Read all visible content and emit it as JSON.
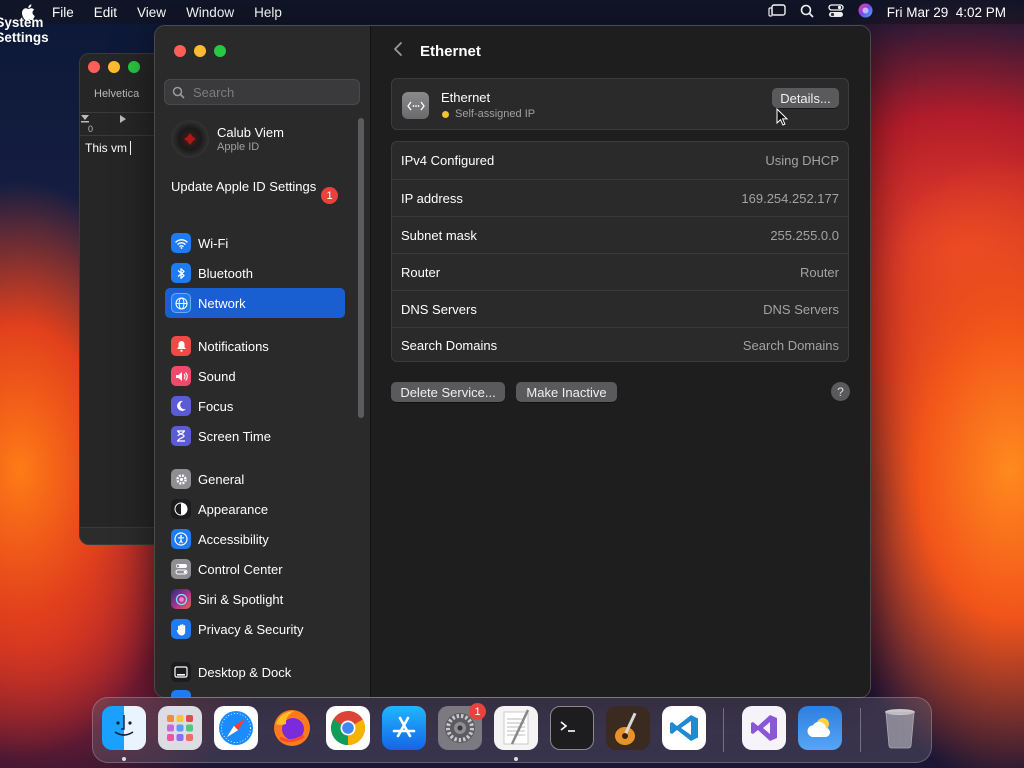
{
  "menubar": {
    "app_name": "System Settings",
    "menus": [
      "File",
      "Edit",
      "View",
      "Window",
      "Help"
    ],
    "datetime": "Fri Mar 29  4:02 PM"
  },
  "background_window": {
    "font_name": "Helvetica",
    "ruler_zero": "0",
    "document_text": "This vm"
  },
  "sidebar": {
    "search_placeholder": "Search",
    "account_name": "Calub Viem",
    "account_subtitle": "Apple ID",
    "update_label": "Update Apple ID Settings",
    "update_badge": "1",
    "items": [
      {
        "label": "Wi-Fi",
        "icon": "wifi-icon",
        "color": "#1e7bf2",
        "selected": false
      },
      {
        "label": "Bluetooth",
        "icon": "bluetooth-icon",
        "color": "#1e7bf2",
        "selected": false
      },
      {
        "label": "Network",
        "icon": "globe-icon",
        "color": "#1e7bf2",
        "selected": true
      },
      {
        "label": "Notifications",
        "icon": "bell-icon",
        "color": "#ef4a46",
        "selected": false
      },
      {
        "label": "Sound",
        "icon": "speaker-icon",
        "color": "#ef4a6a",
        "selected": false
      },
      {
        "label": "Focus",
        "icon": "moon-icon",
        "color": "#5b5bd6",
        "selected": false
      },
      {
        "label": "Screen Time",
        "icon": "hourglass-icon",
        "color": "#5b5bd6",
        "selected": false
      },
      {
        "label": "General",
        "icon": "gear-icon",
        "color": "#8e8e93",
        "selected": false
      },
      {
        "label": "Appearance",
        "icon": "appearance-icon",
        "color": "#1c1c1e",
        "selected": false
      },
      {
        "label": "Accessibility",
        "icon": "accessibility-icon",
        "color": "#1e7bf2",
        "selected": false
      },
      {
        "label": "Control Center",
        "icon": "control-center-icon",
        "color": "#8e8e93",
        "selected": false
      },
      {
        "label": "Siri & Spotlight",
        "icon": "siri-icon",
        "color": "#b4368c",
        "selected": false
      },
      {
        "label": "Privacy & Security",
        "icon": "hand-icon",
        "color": "#1e7bf2",
        "selected": false
      },
      {
        "label": "Desktop & Dock",
        "icon": "dock-icon",
        "color": "#1c1c1e",
        "selected": false
      }
    ]
  },
  "content": {
    "title": "Ethernet",
    "service_name": "Ethernet",
    "service_status": "Self-assigned IP",
    "details_label": "Details...",
    "rows": [
      {
        "label": "IPv4 Configured",
        "value": "Using DHCP"
      },
      {
        "label": "IP address",
        "value": "169.254.252.177"
      },
      {
        "label": "Subnet mask",
        "value": "255.255.0.0"
      },
      {
        "label": "Router",
        "value": "Router"
      },
      {
        "label": "DNS Servers",
        "value": "DNS Servers"
      },
      {
        "label": "Search Domains",
        "value": "Search Domains"
      }
    ],
    "delete_label": "Delete Service...",
    "inactive_label": "Make Inactive",
    "help_label": "?"
  },
  "dock": {
    "settings_badge": "1",
    "apps": [
      "finder-icon",
      "launchpad-icon",
      "safari-icon",
      "firefox-icon",
      "chrome-icon",
      "app-store-icon",
      "system-settings-icon",
      "textedit-icon",
      "terminal-icon",
      "garageband-icon",
      "vscode-icon",
      "visual-studio-icon",
      "weather-icon",
      "trash-icon"
    ]
  }
}
